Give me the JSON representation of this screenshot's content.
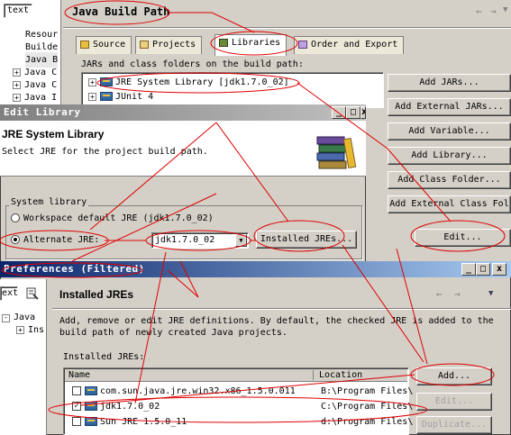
{
  "left_panel": {
    "filter_value": "text",
    "tree": [
      "Resour",
      "Builde",
      "Java B",
      "Java C",
      "Java C",
      "Java I"
    ]
  },
  "properties": {
    "title": "Java Build Path",
    "nav_icons": [
      "back-arrow",
      "forward-arrow",
      "dropdown"
    ],
    "tabs": [
      "Source",
      "Projects",
      "Libraries",
      "Order and Export"
    ],
    "jars_label": "JARs and class folders on the build path:",
    "libraries": [
      "JRE System Library [jdk1.7.0_02]",
      "JUnit 4"
    ],
    "buttons": [
      "Add JARs...",
      "Add External JARs...",
      "Add Variable...",
      "Add Library...",
      "Add Class Folder...",
      "Add External Class Fol",
      "Edit..."
    ]
  },
  "edit_library": {
    "window_title": "Edit Library",
    "heading": "JRE System Library",
    "description": "Select JRE for the project build path.",
    "group_label": "System library",
    "workspace_label": "Workspace default JRE (jdk1.7.0_02)",
    "alternate_label": "Alternate JRE:",
    "alternate_value": "jdk1.7.0_02",
    "installed_button": "Installed JREs..."
  },
  "preferences": {
    "window_title": "Preferences (Filtered)",
    "filter_value": "ext",
    "tree_root": "Java",
    "tree_child": "Ins",
    "heading": "Installed JREs",
    "description": "Add, remove or edit JRE definitions. By default, the checked JRE is added to the build path of newly created Java projects.",
    "list_label": "Installed JREs:",
    "columns": [
      "Name",
      "Location"
    ],
    "rows": [
      {
        "checked": false,
        "name": "com.sun.java.jre.win32.x86_1.5.0.011",
        "location": "B:\\Program Files\\"
      },
      {
        "checked": true,
        "name": "jdk1.7.0_02",
        "location": "C:\\Program Files\\"
      },
      {
        "checked": false,
        "name": "Sun JRE 1.5.0_11",
        "location": "d:\\Program Files\\"
      }
    ],
    "buttons": [
      "Add...",
      "Edit...",
      "Duplicate..."
    ]
  },
  "colors": {
    "titlebar_active": "#0a246a",
    "titlebar_inactive": "#808080",
    "annotation": "#e00000"
  }
}
